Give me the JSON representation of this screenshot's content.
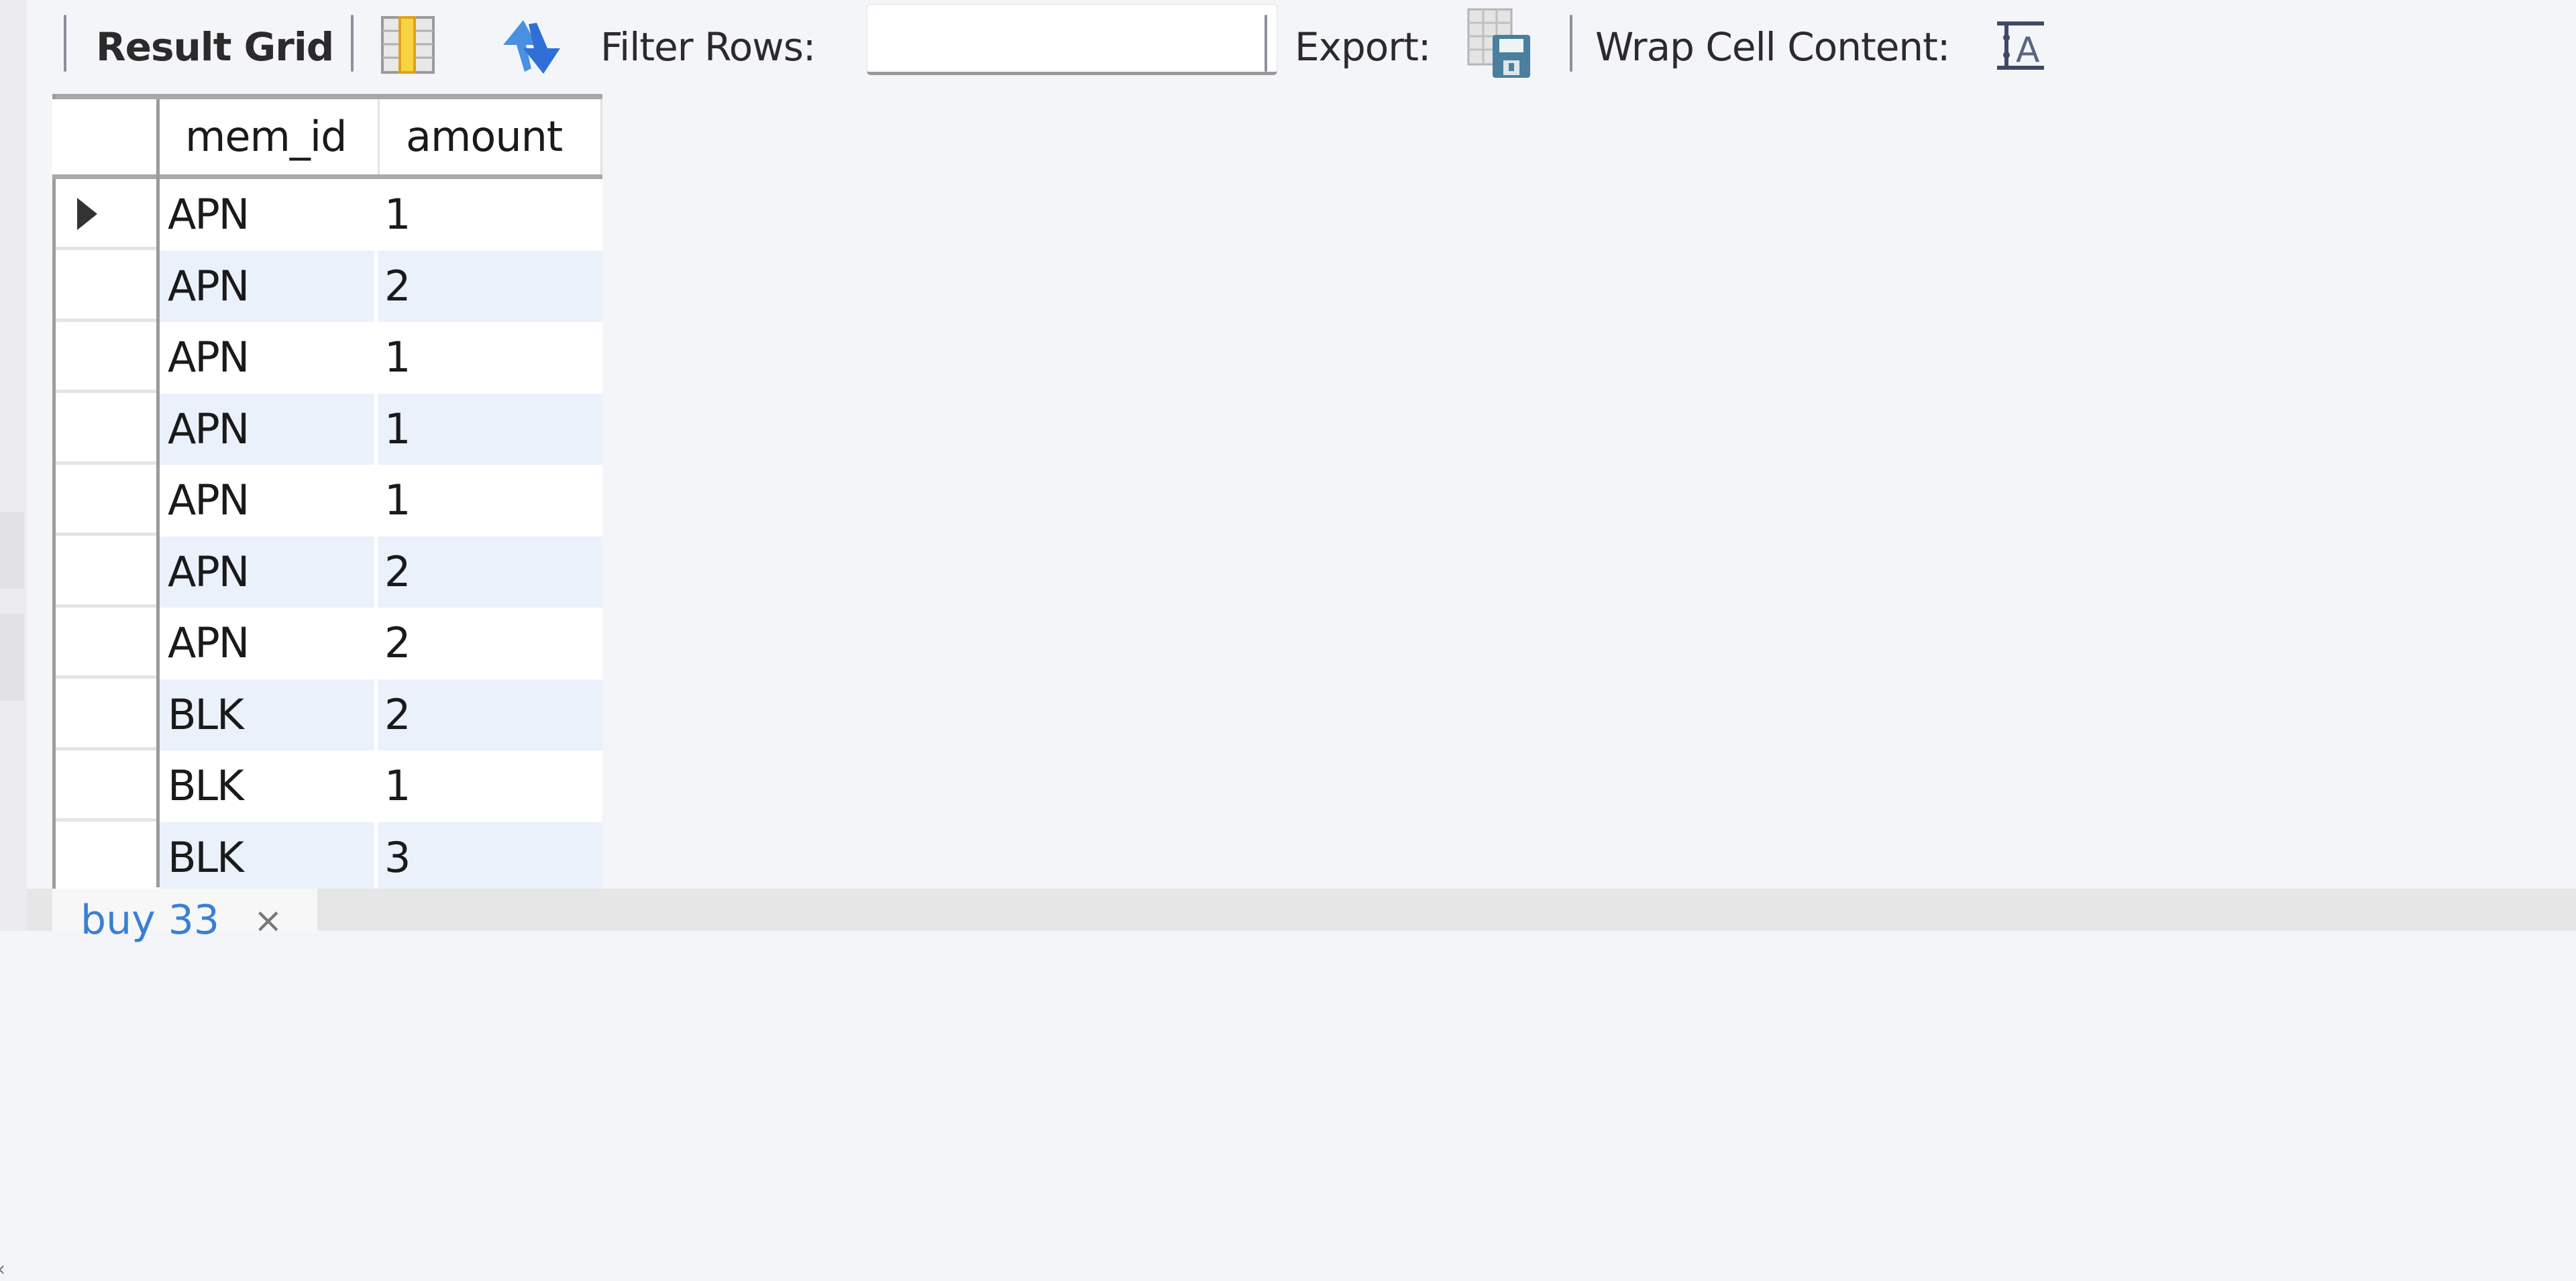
{
  "toolbar": {
    "result_grid_label": "Result Grid",
    "grid_view_icon": "grid-columns-icon",
    "refresh_icon": "refresh-icon",
    "filter_rows_label": "Filter Rows:",
    "filter_rows_value": "",
    "export_label": "Export:",
    "export_icon": "export-save-icon",
    "wrap_cell_label": "Wrap Cell Content:",
    "wrap_cell_icon": "wrap-text-icon"
  },
  "grid": {
    "columns": [
      "mem_id",
      "amount"
    ],
    "rows": [
      {
        "mem_id": "APN",
        "amount": "1"
      },
      {
        "mem_id": "APN",
        "amount": "2"
      },
      {
        "mem_id": "APN",
        "amount": "1"
      },
      {
        "mem_id": "APN",
        "amount": "1"
      },
      {
        "mem_id": "APN",
        "amount": "1"
      },
      {
        "mem_id": "APN",
        "amount": "2"
      },
      {
        "mem_id": "APN",
        "amount": "2"
      },
      {
        "mem_id": "BLK",
        "amount": "2"
      },
      {
        "mem_id": "BLK",
        "amount": "1"
      },
      {
        "mem_id": "BLK",
        "amount": "3"
      }
    ],
    "selected_row": 0
  },
  "tabs": [
    {
      "label": "buy 33",
      "close": "×"
    }
  ],
  "colors": {
    "alt_row": "#eaf1fb",
    "tab_text": "#3a7fd5"
  }
}
